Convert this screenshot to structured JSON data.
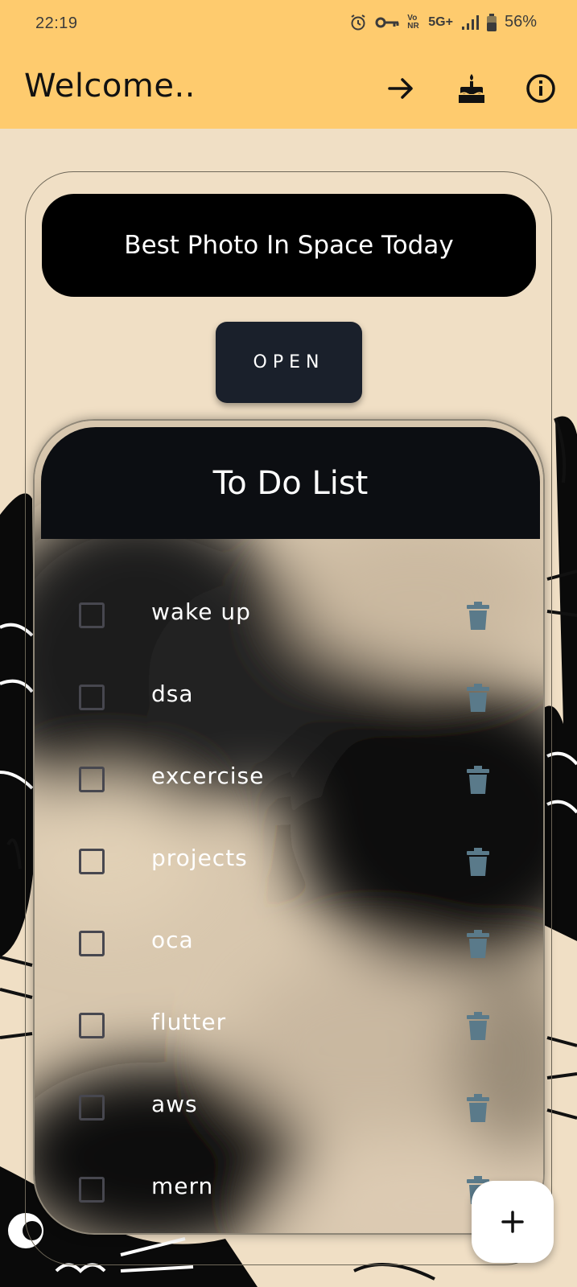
{
  "status_bar": {
    "time": "22:19",
    "network_label": "5G+",
    "volte_label": "Vo NR",
    "battery": "56%"
  },
  "app_bar": {
    "title": "Welcome..",
    "actions": [
      "arrow-forward-icon",
      "cake-icon",
      "info-icon"
    ]
  },
  "photo_banner": {
    "label": "Best Photo In Space Today"
  },
  "open_button": {
    "label": "OPEN"
  },
  "todo": {
    "title": "To Do List",
    "items": [
      {
        "text": "wake up",
        "checked": false
      },
      {
        "text": "dsa",
        "checked": false
      },
      {
        "text": "excercise",
        "checked": false
      },
      {
        "text": "projects",
        "checked": false
      },
      {
        "text": "oca",
        "checked": false
      },
      {
        "text": "flutter",
        "checked": false
      },
      {
        "text": "aws",
        "checked": false
      },
      {
        "text": "mern",
        "checked": false
      }
    ]
  },
  "fab": {
    "icon": "plus-icon"
  },
  "colors": {
    "app_bar": "#fecb6e",
    "background": "#f0dfc5",
    "delete_icon": "#5a7a8a",
    "open_button": "#1a202b"
  }
}
